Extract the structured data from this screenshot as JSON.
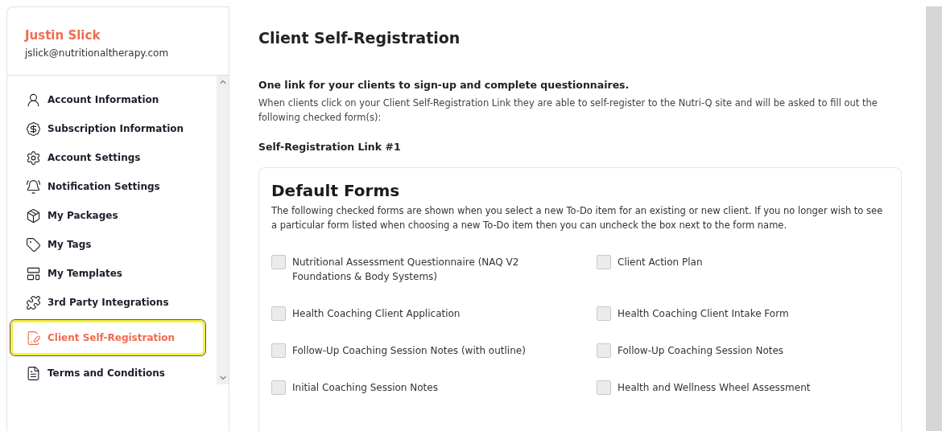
{
  "profile": {
    "name": "Justin Slick",
    "email": "jslick@nutritionaltherapy.com"
  },
  "sidebar": {
    "items": [
      {
        "label": "Account Information",
        "selected": false
      },
      {
        "label": "Subscription Information",
        "selected": false
      },
      {
        "label": "Account Settings",
        "selected": false
      },
      {
        "label": "Notification Settings",
        "selected": false
      },
      {
        "label": "My Packages",
        "selected": false
      },
      {
        "label": "My Tags",
        "selected": false
      },
      {
        "label": "My Templates",
        "selected": false
      },
      {
        "label": "3rd Party Integrations",
        "selected": false
      },
      {
        "label": "Client Self-Registration",
        "selected": true
      },
      {
        "label": "Terms and Conditions",
        "selected": false
      }
    ]
  },
  "page": {
    "title": "Client Self-Registration",
    "intro_heading": "One link for your clients to sign-up and complete questionnaires.",
    "intro_text": "When clients click on your Client Self-Registration Link they are able to self-register to the Nutri-Q site and will be asked to fill out the following checked form(s):",
    "link_heading": "Self-Registration Link #1"
  },
  "default_forms": {
    "title": "Default Forms",
    "description": "The following checked forms are shown when you select a new To-Do item for an existing or new client. If you no longer wish to see a particular form listed when choosing a new To-Do item then you can uncheck the box next to the form name.",
    "forms": [
      {
        "label": "Nutritional Assessment Questionnaire (NAQ V2 Foundations & Body Systems)",
        "checked": false
      },
      {
        "label": "Client Action Plan",
        "checked": false
      },
      {
        "label": "Health Coaching Client Application",
        "checked": false
      },
      {
        "label": "Health Coaching Client Intake Form",
        "checked": false
      },
      {
        "label": "Follow-Up Coaching Session Notes (with outline)",
        "checked": false
      },
      {
        "label": "Follow-Up Coaching Session Notes",
        "checked": false
      },
      {
        "label": "Initial Coaching Session Notes",
        "checked": false
      },
      {
        "label": "Health and Wellness Wheel Assessment",
        "checked": false
      }
    ]
  }
}
